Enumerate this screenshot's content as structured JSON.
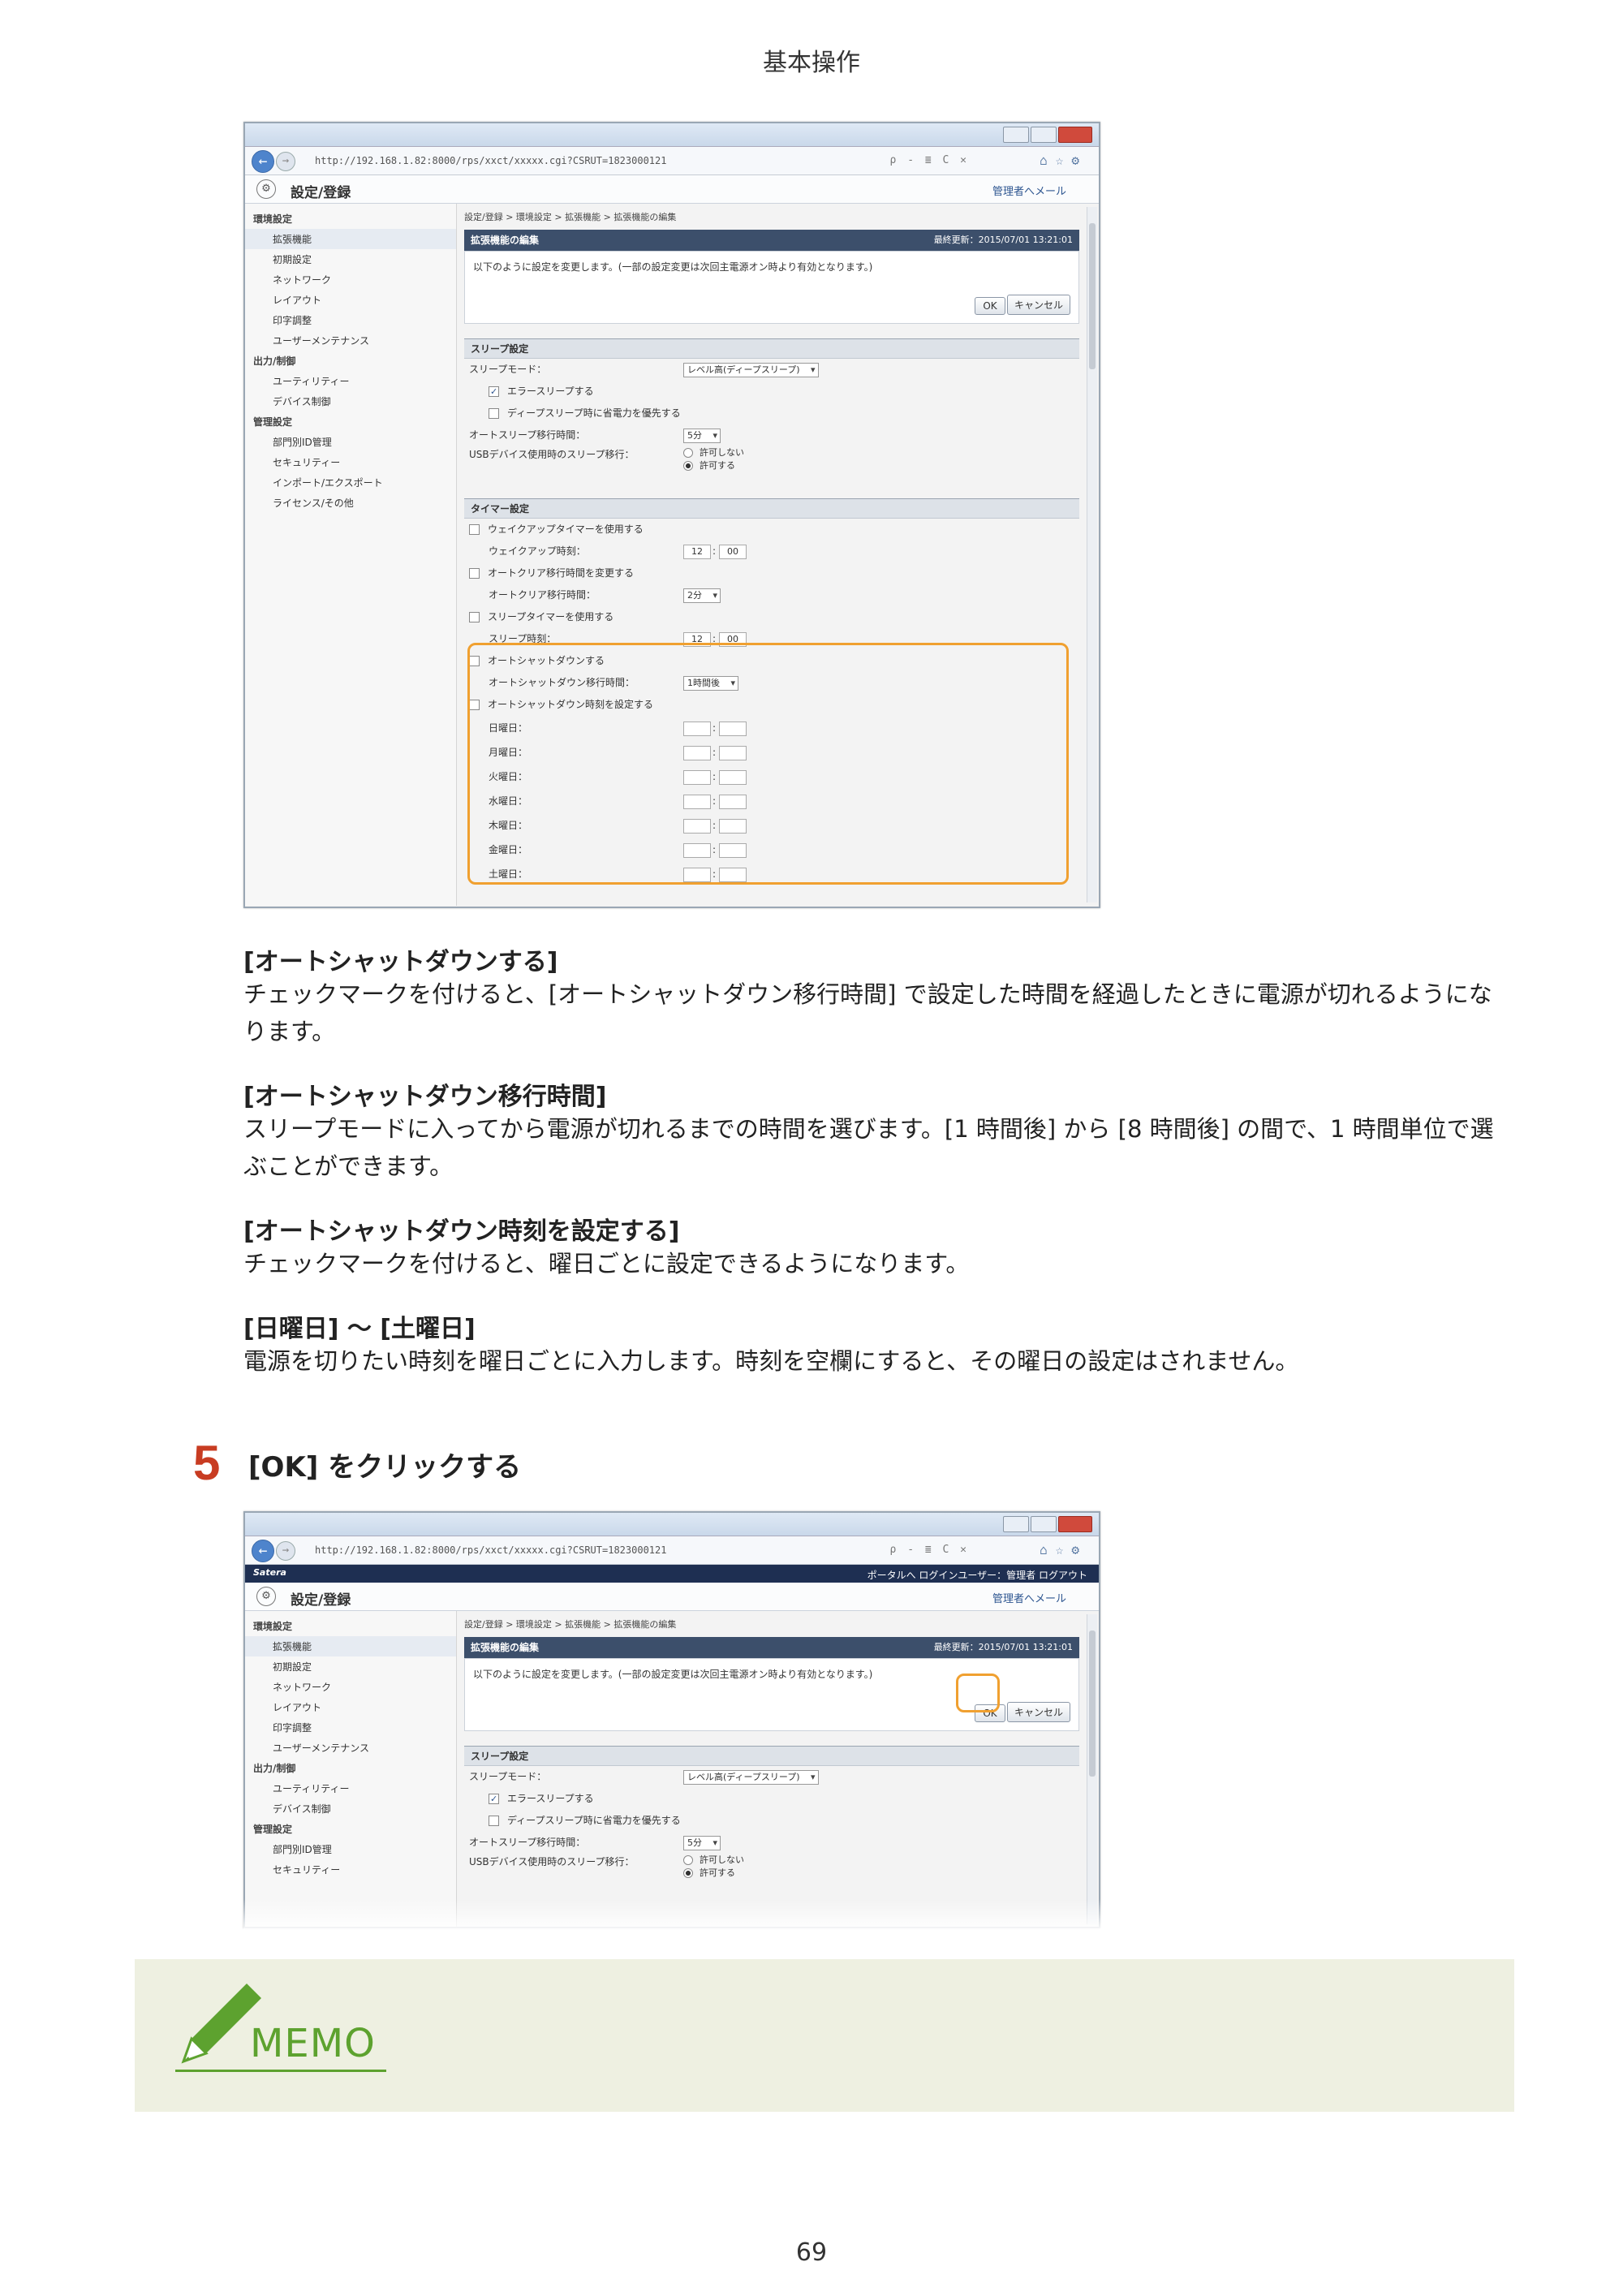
{
  "header": {
    "title": "基本操作"
  },
  "shot1": {
    "url": "http://192.168.1.82:8000/rps/xxct/xxxxx.cgi?CSRUT=1823000121",
    "url_tools": "ρ - ≣ C ✕",
    "app_title": "設定/登録",
    "mail_link": "管理者へメール",
    "sidebar": {
      "sections": [
        {
          "title": "環境設定",
          "items": [
            "拡張機能",
            "初期設定",
            "ネットワーク",
            "レイアウト",
            "印字調整",
            "ユーザーメンテナンス"
          ]
        },
        {
          "title": "出力/制御",
          "items": [
            "ユーティリティー",
            "デバイス制御"
          ]
        },
        {
          "title": "管理設定",
          "items": [
            "部門別ID管理",
            "セキュリティー",
            "インポート/エクスポート",
            "ライセンス/その他"
          ]
        }
      ]
    },
    "breadcrumb": "設定/登録 > 環境設定 > 拡張機能 > 拡張機能の編集",
    "page_header": "拡張機能の編集",
    "timestamp": "最終更新：2015/07/01 13:21:01",
    "info_text": "以下のように設定を変更します。(一部の設定変更は次回主電源オン時より有効となります。)",
    "ok": "OK",
    "cancel": "キャンセル",
    "sleep": {
      "section": "スリープ設定",
      "mode_label": "スリープモード：",
      "mode_value": "レベル高(ディープスリープ)",
      "err_sleep": "エラースリープする",
      "deep_sleep": "ディープスリープ時に省電力を優先する",
      "auto_sleep_label": "オートスリープ移行時間：",
      "auto_sleep_value": "5分",
      "usb_label": "USBデバイス使用時のスリープ移行：",
      "usb_deny": "許可しない",
      "usb_allow": "許可する"
    },
    "timer": {
      "section": "タイマー設定",
      "wakeup": "ウェイクアップタイマーを使用する",
      "wakeup_time_label": "ウェイクアップ時刻：",
      "hour": "12",
      "minute": "00",
      "auto_clear": "オートクリア移行時間を変更する",
      "auto_clear_label": "オートクリア移行時間：",
      "auto_clear_value": "2分",
      "sleep_timer": "スリープタイマーを使用する",
      "sleep_time_label": "スリープ時刻：",
      "auto_shutdown": "オートシャットダウンする",
      "auto_shutdown_time_label": "オートシャットダウン移行時間：",
      "auto_shutdown_time_value": "1時間後",
      "auto_shutdown_clock": "オートシャットダウン時刻を設定する",
      "days": [
        "日曜日：",
        "月曜日：",
        "火曜日：",
        "水曜日：",
        "木曜日：",
        "金曜日：",
        "土曜日："
      ]
    }
  },
  "items": [
    {
      "term": "[オートシャットダウンする]",
      "desc": "チェックマークを付けると、[オートシャットダウン移行時間] で設定した時間を経過したときに電源が切れるようになります。"
    },
    {
      "term": "[オートシャットダウン移行時間]",
      "desc": "スリープモードに入ってから電源が切れるまでの時間を選びます。[1 時間後] から [8 時間後] の間で、1 時間単位で選ぶことができます。"
    },
    {
      "term": "[オートシャットダウン時刻を設定する]",
      "desc": "チェックマークを付けると、曜日ごとに設定できるようになります。"
    },
    {
      "term": "[日曜日] 〜 [土曜日]",
      "desc": "電源を切りたい時刻を曜日ごとに入力します。時刻を空欄にすると、その曜日の設定はされません。"
    }
  ],
  "step": {
    "number": "5",
    "label": "[OK] をクリックする"
  },
  "shot2": {
    "brand": "Satera",
    "top_links": "ポータルへ  ログインユーザー：管理者 ログアウト"
  },
  "memo": {
    "label": "MEMO"
  },
  "footer": {
    "page_number": "69"
  },
  "colors": {
    "highlight": "#f0a030",
    "step_number": "#c83c22",
    "memo_green": "#5da22f",
    "memo_bg": "#eef0e1"
  }
}
